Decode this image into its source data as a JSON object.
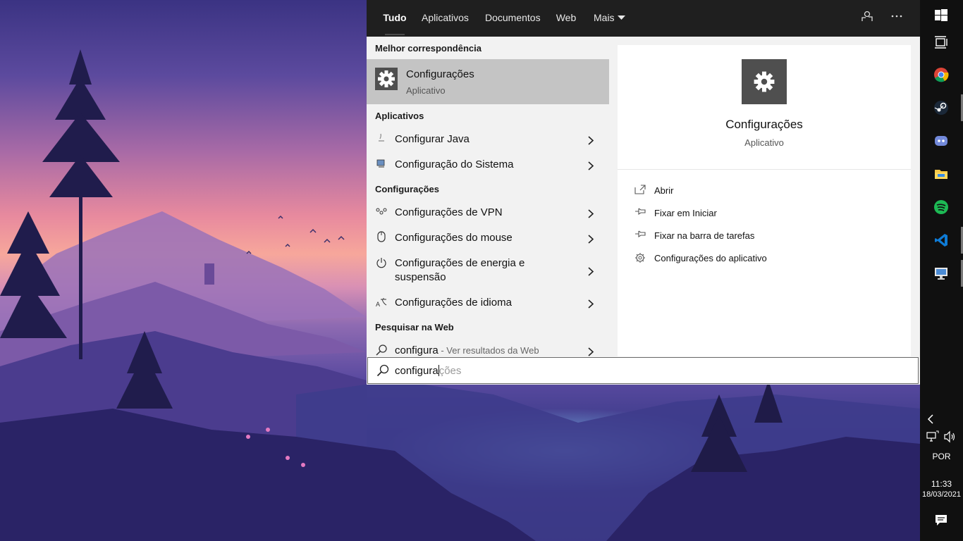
{
  "search_tabs": [
    {
      "label": "Tudo"
    },
    {
      "label": "Aplicativos"
    },
    {
      "label": "Documentos"
    },
    {
      "label": "Web"
    },
    {
      "label": "Mais"
    }
  ],
  "best_match": {
    "heading": "Melhor correspondência",
    "title": "Configurações",
    "subtitle": "Aplicativo"
  },
  "apps_section": {
    "heading": "Aplicativos",
    "items": [
      {
        "label": "Configurar Java",
        "icon": "java-icon"
      },
      {
        "label": "Configuração do Sistema",
        "icon": "system-config-icon"
      }
    ]
  },
  "settings_section": {
    "heading": "Configurações",
    "items": [
      {
        "label": "Configurações de VPN",
        "icon": "vpn-icon"
      },
      {
        "label": "Configurações do mouse",
        "icon": "mouse-icon"
      },
      {
        "label": "Configurações de energia e suspensão",
        "icon": "power-icon"
      },
      {
        "label": "Configurações de idioma",
        "icon": "language-icon"
      }
    ]
  },
  "web_section": {
    "heading": "Pesquisar na Web",
    "query": "configura",
    "suffix": " - Ver resultados da Web"
  },
  "preview": {
    "title": "Configurações",
    "subtitle": "Aplicativo",
    "actions": [
      {
        "label": "Abrir",
        "icon": "open-icon"
      },
      {
        "label": "Fixar em Iniciar",
        "icon": "pin-icon"
      },
      {
        "label": "Fixar na barra de tarefas",
        "icon": "pin-icon"
      },
      {
        "label": "Configurações do aplicativo",
        "icon": "gear-icon"
      }
    ]
  },
  "search_box": {
    "typed": "configura",
    "hint": "ções"
  },
  "tray": {
    "language": "POR",
    "time": "11:33",
    "date": "18/03/2021"
  },
  "colors": {
    "taskbar": "#101010",
    "panel": "#f2f2f2",
    "selected": "#c4c4c4",
    "app_tile": "#4f4f4f"
  }
}
